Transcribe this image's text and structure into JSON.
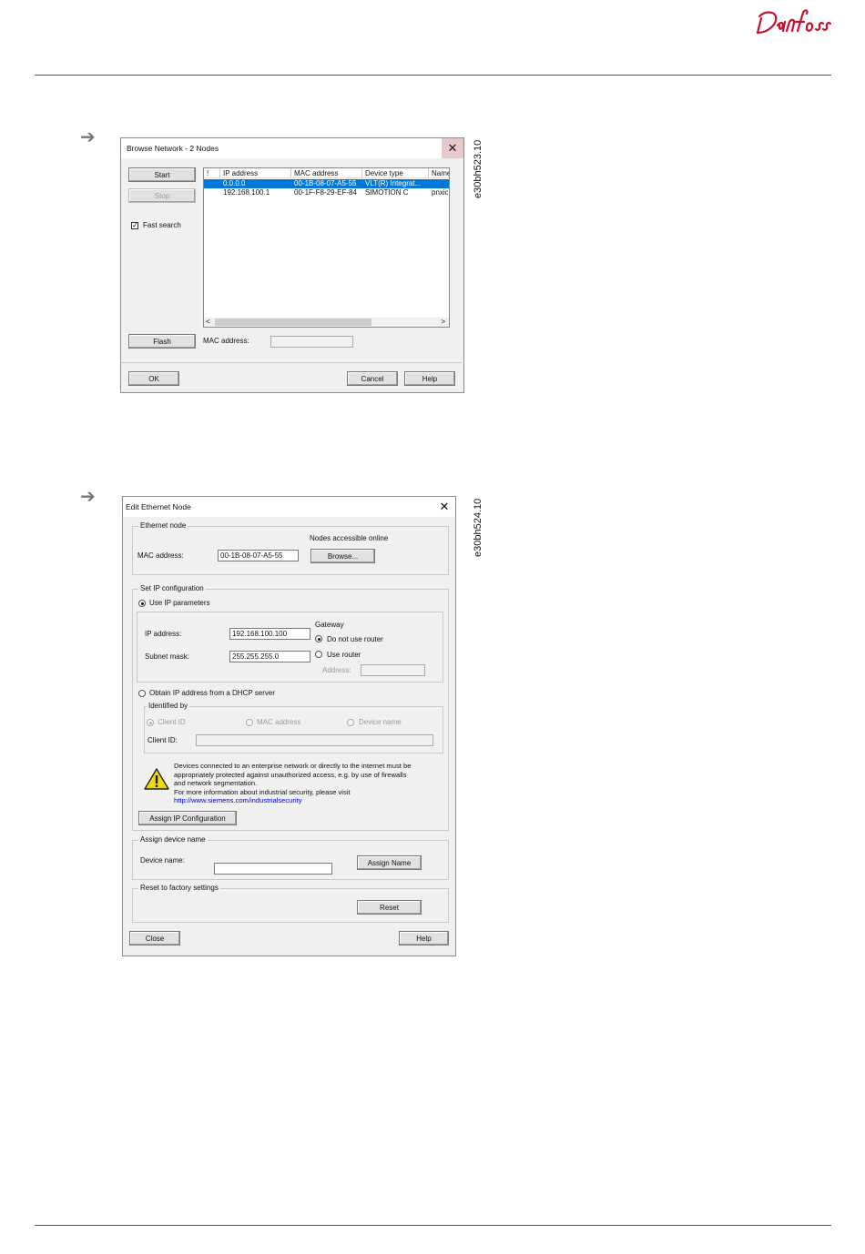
{
  "page": {
    "fig1_id": "e30bh523.10",
    "fig2_id": "e30bh524.10"
  },
  "browse_network": {
    "title": "Browse Network - 2 Nodes",
    "start": "Start",
    "stop": "Stop",
    "fast_search": "Fast search",
    "columns": [
      "!",
      "IP address",
      "MAC address",
      "Device type",
      "Name"
    ],
    "rows": [
      [
        "",
        "0.0.0.0",
        "00-1B-08-07-A5-55",
        "VLT(R) Integrat...",
        ""
      ],
      [
        "",
        "192.168.100.1",
        "00-1F-F8-29-EF-84",
        "SIMOTION C",
        "pnxio"
      ]
    ],
    "flash": "Flash",
    "mac_label": "MAC address:",
    "mac_value": "",
    "ok": "OK",
    "cancel": "Cancel",
    "help": "Help"
  },
  "edit_node": {
    "title": "Edit Ethernet Node",
    "ethernet_node": "Ethernet node",
    "nodes_online": "Nodes accessible online",
    "mac_label": "MAC address:",
    "mac_value": "00-1B-08-07-A5-55",
    "browse": "Browse...",
    "set_ip": "Set IP configuration",
    "use_ip": "Use IP parameters",
    "ip_label": "IP address:",
    "ip_value": "192.168.100.100",
    "subnet_label": "Subnet mask:",
    "subnet_value": "255.255.255.0",
    "gateway": "Gateway",
    "no_router": "Do not use router",
    "use_router": "Use router",
    "address_label": "Address:",
    "dhcp": "Obtain IP address from a DHCP server",
    "identified_by": "Identified by",
    "client_id": "Client ID",
    "mac_address_opt": "MAC address",
    "device_name_opt": "Device name",
    "client_id_label": "Client ID:",
    "warning_lines": [
      "Devices connected to an enterprise network or directly to the internet must be",
      "appropriately protected against unauthorized access, e.g. by use of firewalls",
      "and network segmentation.",
      "For more information about industrial security, please visit"
    ],
    "warning_link": "http://www.siemens.com/industrialsecurity",
    "assign_ip": "Assign IP Configuration",
    "assign_device_name": "Assign device name",
    "device_name_label": "Device name:",
    "device_name_value": "",
    "assign_name": "Assign Name",
    "reset_factory": "Reset to factory settings",
    "reset": "Reset",
    "close": "Close",
    "help": "Help"
  }
}
